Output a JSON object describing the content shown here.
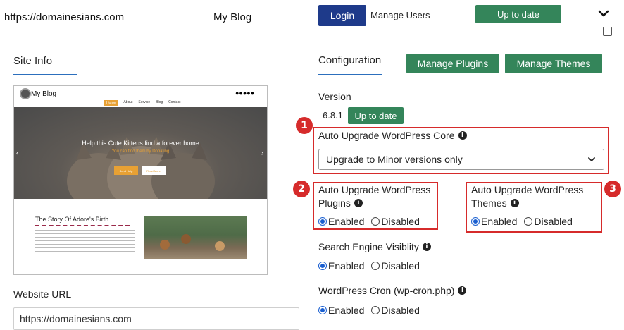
{
  "topbar": {
    "site_url": "https://domainesians.com",
    "blog_name": "My Blog",
    "login_label": "Login",
    "manage_users_label": "Manage Users",
    "status_label": "Up to date",
    "expand_icon": "chevron-down-icon",
    "select_checked": false
  },
  "site_info": {
    "title": "Site Info",
    "preview": {
      "site_title": "My Blog",
      "nav": [
        "Home",
        "About",
        "Service",
        "Blog",
        "Contact"
      ],
      "hero_heading": "Help this Cute Kittens find a forever home",
      "hero_sub": "You can find them by Donating",
      "hero_buttons": [
        "Send Help",
        "Read More"
      ],
      "story_title": "The Story Of Adore's Birth",
      "header_icons": "●●●●●"
    },
    "website_url_label": "Website URL",
    "website_url_value": "https://domainesians.com"
  },
  "configuration": {
    "title": "Configuration",
    "manage_plugins_label": "Manage Plugins",
    "manage_themes_label": "Manage Themes",
    "version_label": "Version",
    "version_value": "6.8.1",
    "version_status_label": "Up to date",
    "core": {
      "badge": "1",
      "label": "Auto Upgrade WordPress Core",
      "selected": "Upgrade to Minor versions only"
    },
    "plugins": {
      "badge": "2",
      "label_line1": "Auto Upgrade WordPress",
      "label_line2": "Plugins",
      "enabled_label": "Enabled",
      "disabled_label": "Disabled",
      "value": "Enabled"
    },
    "themes": {
      "badge": "3",
      "label_line1": "Auto Upgrade WordPress",
      "label_line2": "Themes",
      "enabled_label": "Enabled",
      "disabled_label": "Disabled",
      "value": "Enabled"
    },
    "search_engine": {
      "label": "Search Engine Visiblity",
      "enabled_label": "Enabled",
      "disabled_label": "Disabled",
      "value": "Enabled"
    },
    "cron": {
      "label": "WordPress Cron (wp-cron.php)",
      "enabled_label": "Enabled",
      "disabled_label": "Disabled",
      "value": "Enabled"
    }
  },
  "colors": {
    "primary_blue": "#1e3a8a",
    "success_green": "#34855a",
    "highlight_red": "#d62b2b",
    "accent_underline": "#2c6fbd"
  }
}
